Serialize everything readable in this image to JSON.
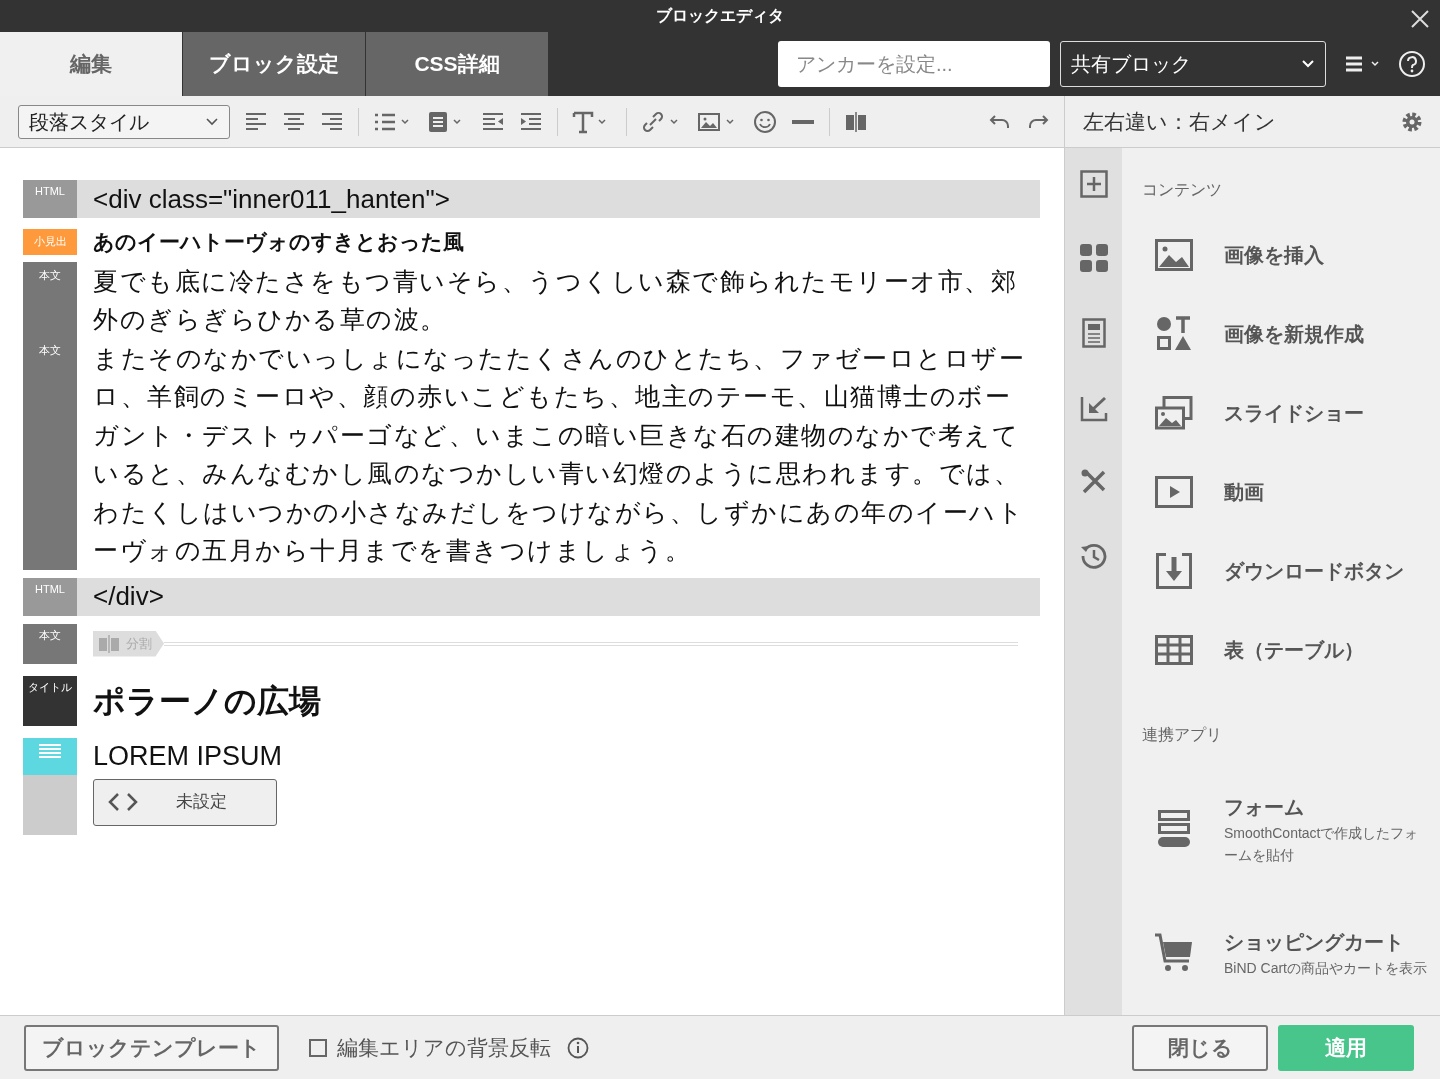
{
  "window": {
    "title": "ブロックエディタ"
  },
  "tabs": [
    {
      "label": "編集",
      "selected": true
    },
    {
      "label": "ブロック設定",
      "selected": false
    },
    {
      "label": "CSS詳細",
      "selected": false
    }
  ],
  "anchor_field": {
    "placeholder": "アンカーを設定..."
  },
  "shared_block_select": {
    "value": "共有ブロック"
  },
  "paragraph_style_select": {
    "value": "段落スタイル"
  },
  "side_header": {
    "title": "左右違い：右メイン"
  },
  "blocks": [
    {
      "kind": "html",
      "tag": "HTML",
      "text": "<div class=\"inner011_hanten\">"
    },
    {
      "kind": "subheading",
      "tag": "小見出",
      "text": "あのイーハトーヴォのすきとおった風"
    },
    {
      "kind": "body",
      "paragraphs": [
        {
          "tag": "本文",
          "text": "夏でも底に冷たさをもつ青いそら、うつくしい森で飾られたモリーオ市、郊外のぎらぎらひかる草の波。"
        },
        {
          "tag": "本文",
          "text": "またそのなかでいっしょになったたくさんのひとたち、ファゼーロとロザーロ、羊飼のミーロや、顔の赤いこどもたち、地主のテーモ、山猫博士のボーガント・デストゥパーゴなど、いまこの暗い巨きな石の建物のなかで考えていると、みんなむかし風のなつかしい青い幻燈のように思われます。では、わたくしはいつかの小さなみだしをつけながら、しずかにあの年のイーハトーヴォの五月から十月までを書きつけましょう。"
        }
      ]
    },
    {
      "kind": "html",
      "tag": "HTML",
      "text": "</div>"
    },
    {
      "kind": "split",
      "tag": "本文",
      "label": "分割"
    },
    {
      "kind": "title",
      "tag": "タイトル",
      "text": "ポラーノの広場"
    },
    {
      "kind": "widget",
      "text": "LOREM IPSUM",
      "button": "未設定"
    }
  ],
  "sections": [
    {
      "heading": "コンテンツ",
      "items": [
        {
          "label": "画像を挿入"
        },
        {
          "label": "画像を新規作成"
        },
        {
          "label": "スライドショー"
        },
        {
          "label": "動画"
        },
        {
          "label": "ダウンロードボタン"
        },
        {
          "label": "表（テーブル）"
        }
      ]
    },
    {
      "heading": "連携アプリ",
      "items": [
        {
          "label": "フォーム",
          "description": "SmoothContactで作成したフォームを貼付"
        },
        {
          "label": "ショッピングカート",
          "description": "BiND Cartの商品やカートを表示"
        }
      ]
    }
  ],
  "footer": {
    "template_button": "ブロックテンプレート",
    "invert_checkbox": {
      "label": "編集エリアの背景反転",
      "checked": false
    },
    "close_button": "閉じる",
    "apply_button": "適用"
  }
}
